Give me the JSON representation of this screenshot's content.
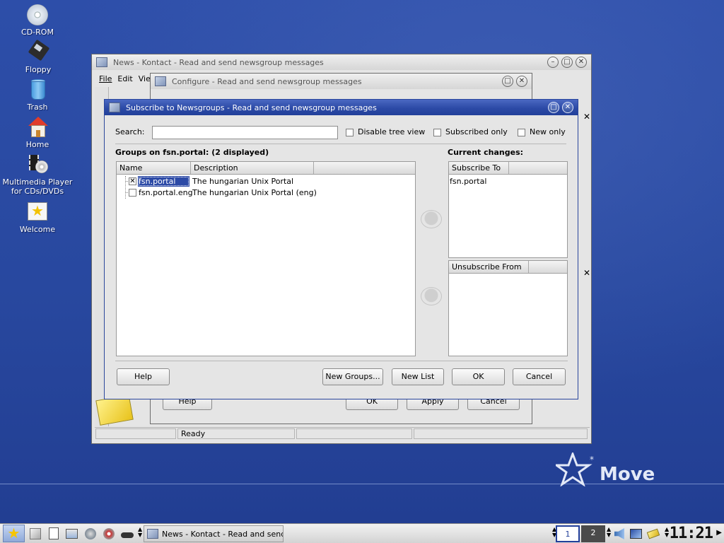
{
  "desktop": {
    "icons": [
      {
        "label": "CD-ROM"
      },
      {
        "label": "Floppy"
      },
      {
        "label": "Trash"
      },
      {
        "label": "Home"
      },
      {
        "label": "Multimedia Player\nfor CDs/DVDs"
      },
      {
        "label": "Welcome"
      }
    ],
    "logo_text": "Move"
  },
  "kontact": {
    "title": "News - Kontact - Read and send newsgroup messages",
    "menu": [
      "File",
      "Edit",
      "Vie"
    ],
    "status": "Ready"
  },
  "configure": {
    "title": "Configure - Read and send newsgroup messages",
    "buttons": {
      "help": "Help",
      "ok": "OK",
      "apply": "Apply",
      "cancel": "Cancel"
    }
  },
  "subscribe": {
    "title": "Subscribe to Newsgroups - Read and send newsgroup messages",
    "search_label": "Search:",
    "search_value": "",
    "options": {
      "disable_tree": "Disable tree view",
      "subscribed_only": "Subscribed only",
      "new_only": "New only"
    },
    "groups_header": "Groups on fsn.portal: (2 displayed)",
    "columns": {
      "name": "Name",
      "description": "Description"
    },
    "groups": [
      {
        "name": "fsn.portal",
        "description": "The hungarian Unix Portal",
        "checked": true
      },
      {
        "name": "fsn.portal.eng",
        "description": "The hungarian Unix Portal (eng)",
        "checked": false
      }
    ],
    "current_changes": "Current changes:",
    "subscribe_to_header": "Subscribe To",
    "subscribe_to": [
      "fsn.portal"
    ],
    "unsubscribe_from_header": "Unsubscribe From",
    "buttons": {
      "help": "Help",
      "new_groups": "New Groups...",
      "new_list": "New List",
      "ok": "OK",
      "cancel": "Cancel"
    }
  },
  "taskbar": {
    "task_label": "News - Kontact - Read and send newsgroup messages",
    "pager": [
      "1",
      "2"
    ],
    "clock": "11:21"
  }
}
